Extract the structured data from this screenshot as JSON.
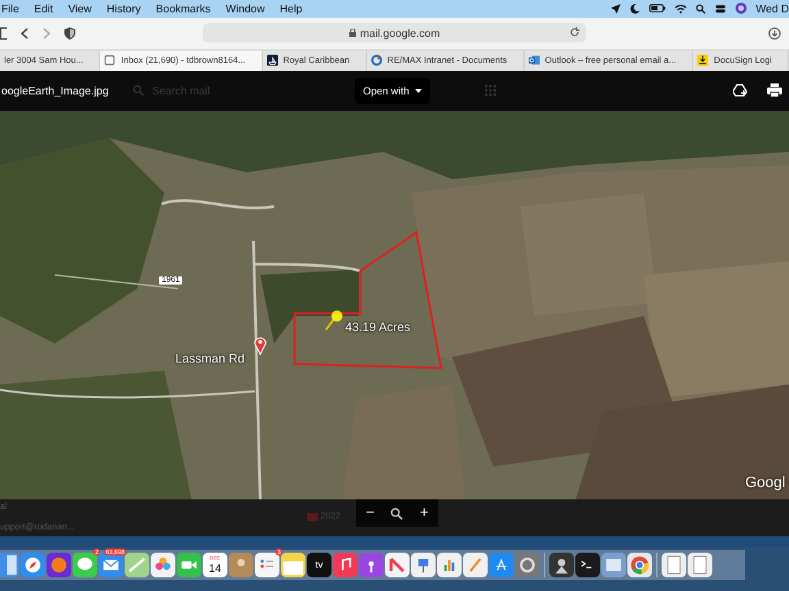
{
  "menubar": {
    "items": [
      {
        "label": "File"
      },
      {
        "label": "Edit"
      },
      {
        "label": "View"
      },
      {
        "label": "History"
      },
      {
        "label": "Bookmarks"
      },
      {
        "label": "Window"
      },
      {
        "label": "Help"
      }
    ],
    "clock": "Wed D"
  },
  "browser": {
    "address": "mail.google.com",
    "tabs": [
      {
        "label": "ler 3004 Sam Hou...",
        "selected": false,
        "kind": "blank"
      },
      {
        "label": "Inbox (21,690) - tdbrown8164...",
        "selected": true,
        "kind": "mail"
      },
      {
        "label": "Royal Caribbean",
        "selected": false,
        "kind": "ship"
      },
      {
        "label": "RE/MAX Intranet - Documents",
        "selected": false,
        "kind": "ring"
      },
      {
        "label": "Outlook – free personal email a...",
        "selected": false,
        "kind": "outlook"
      },
      {
        "label": "DocuSign Logi",
        "selected": false,
        "kind": "download"
      }
    ]
  },
  "viewer": {
    "filename": "oogleEarth_Image.jpg",
    "search_placeholder": "Search mail",
    "open_with": "Open with"
  },
  "map": {
    "road_label": "Lassman Rd",
    "parcel_label": "43.19 Acres",
    "highway": "1961",
    "attribution": "Googl"
  },
  "footer": {
    "sender": "al",
    "email": "upport@rodanan...",
    "attachment": "2022",
    "zoom_out": "−",
    "zoom_in": "+"
  },
  "dock": [
    {
      "kind": "finder"
    },
    {
      "kind": "safari"
    },
    {
      "kind": "firefox"
    },
    {
      "kind": "messages",
      "badge": "2"
    },
    {
      "kind": "mail",
      "badge": "63,698"
    },
    {
      "kind": "maps"
    },
    {
      "kind": "photos"
    },
    {
      "kind": "facetime"
    },
    {
      "kind": "calendar",
      "month": "DEC",
      "day": "14"
    },
    {
      "kind": "contacts"
    },
    {
      "kind": "reminders",
      "badge": "3"
    },
    {
      "kind": "notes"
    },
    {
      "kind": "tv",
      "label": "tv"
    },
    {
      "kind": "music"
    },
    {
      "kind": "podcasts"
    },
    {
      "kind": "news"
    },
    {
      "kind": "keynote"
    },
    {
      "kind": "numbers"
    },
    {
      "kind": "pages"
    },
    {
      "kind": "appstore"
    },
    {
      "kind": "settings"
    },
    {
      "kind": "separator"
    },
    {
      "kind": "agent"
    },
    {
      "kind": "terminal"
    },
    {
      "kind": "preview"
    },
    {
      "kind": "chrome"
    },
    {
      "kind": "separator"
    },
    {
      "kind": "document"
    },
    {
      "kind": "document"
    }
  ]
}
